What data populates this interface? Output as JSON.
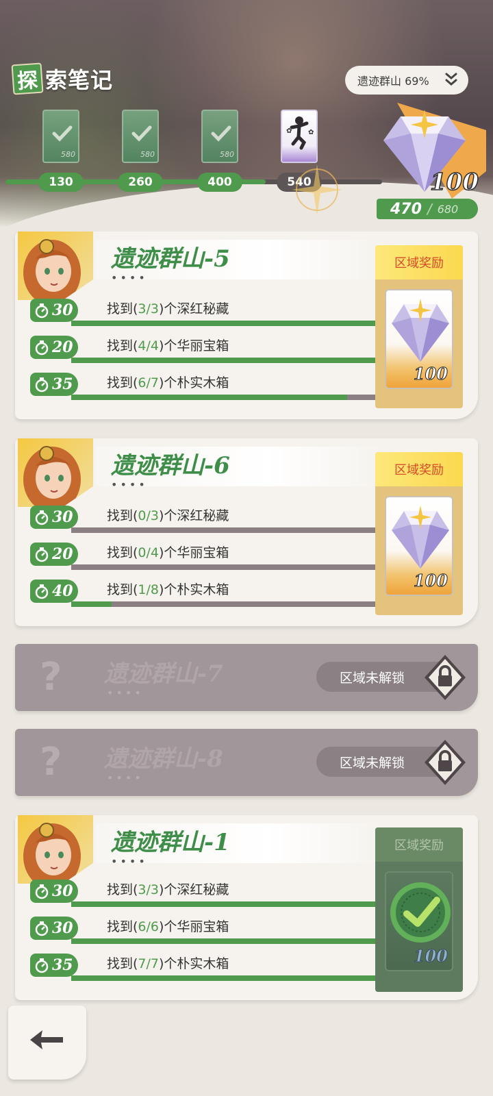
{
  "header": {
    "title_first_char": "探",
    "title_rest": "索笔记",
    "region_select_label": "遗迹群山 69%",
    "milestones": [
      {
        "value": "130",
        "card_number": "580",
        "claimed": true
      },
      {
        "value": "260",
        "card_number": "580",
        "claimed": true
      },
      {
        "value": "400",
        "card_number": "580",
        "claimed": true
      },
      {
        "value": "540",
        "claimed": false
      }
    ],
    "big_reward_count": "100",
    "progress_current": "470",
    "progress_separator": "/",
    "progress_max": "680",
    "progress_fraction": 0.69
  },
  "areas": [
    {
      "name": "遗迹群山-5",
      "dots": "••••",
      "reward_label": "区域奖励",
      "reward_count": "100",
      "claimed": false,
      "tasks": [
        {
          "points": "30",
          "pre": "找到(",
          "progress": "3/3",
          "post": ")个深红秘藏",
          "fill": 1.0
        },
        {
          "points": "20",
          "pre": "找到(",
          "progress": "4/4",
          "post": ")个华丽宝箱",
          "fill": 1.0
        },
        {
          "points": "35",
          "pre": "找到(",
          "progress": "6/7",
          "post": ")个朴实木箱",
          "fill": 0.857
        }
      ]
    },
    {
      "name": "遗迹群山-6",
      "dots": "••••",
      "reward_label": "区域奖励",
      "reward_count": "100",
      "claimed": false,
      "tasks": [
        {
          "points": "30",
          "pre": "找到(",
          "progress": "0/3",
          "post": ")个深红秘藏",
          "fill": 0.0
        },
        {
          "points": "20",
          "pre": "找到(",
          "progress": "0/4",
          "post": ")个华丽宝箱",
          "fill": 0.0
        },
        {
          "points": "40",
          "pre": "找到(",
          "progress": "1/8",
          "post": ")个朴实木箱",
          "fill": 0.125
        }
      ]
    },
    {
      "name": "遗迹群山-1",
      "dots": "••••",
      "reward_label": "区域奖励",
      "reward_count": "100",
      "claimed": true,
      "tasks": [
        {
          "points": "30",
          "pre": "找到(",
          "progress": "3/3",
          "post": ")个深红秘藏",
          "fill": 1.0
        },
        {
          "points": "30",
          "pre": "找到(",
          "progress": "6/6",
          "post": ")个华丽宝箱",
          "fill": 1.0
        },
        {
          "points": "35",
          "pre": "找到(",
          "progress": "7/7",
          "post": ")个朴实木箱",
          "fill": 1.0
        }
      ]
    }
  ],
  "locked_areas": [
    {
      "name": "遗迹群山-7",
      "dots": "••••",
      "status": "区域未解锁",
      "question": "?"
    },
    {
      "name": "遗迹群山-8",
      "dots": "••••",
      "status": "区域未解锁",
      "question": "?"
    }
  ],
  "icons": {
    "back": "back-arrow-icon",
    "lock": "lock-icon",
    "chevron": "double-chevron-down-icon",
    "gem": "diamond-gem-icon",
    "stopwatch": "stopwatch-icon"
  },
  "colors": {
    "accent_green": "#4f9a4c",
    "reward_red": "#d84a2a",
    "locked_gray": "#a1969a"
  }
}
